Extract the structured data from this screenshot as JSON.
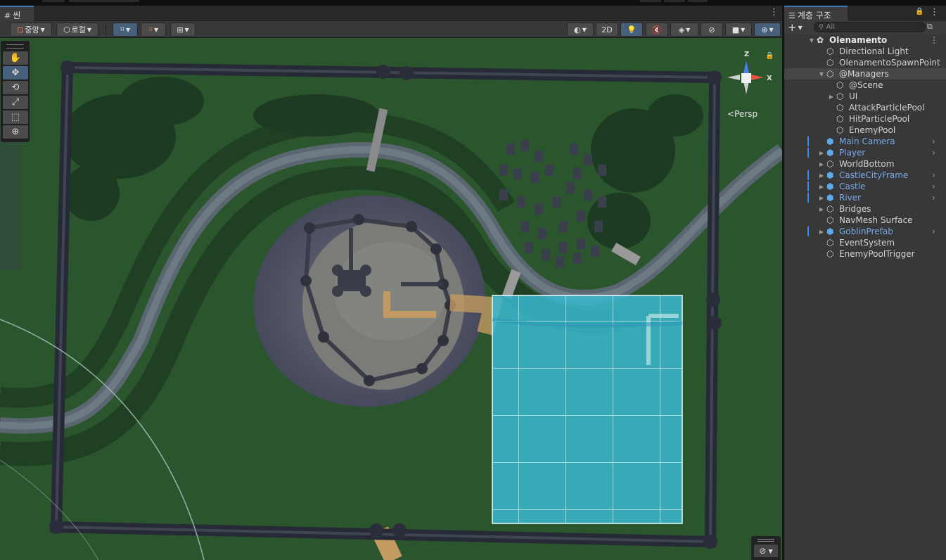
{
  "scene_panel": {
    "tab_title": "씬",
    "tab_icon": "grid-icon",
    "toolbar": {
      "pivot_label": "중앙",
      "space_label": "로컬",
      "view_2d_label": "2D"
    },
    "gizmo": {
      "axis_y": "Z",
      "axis_x": "X",
      "projection": "Persp"
    },
    "tools": [
      "hand-tool",
      "move-tool",
      "rotate-tool",
      "scale-tool",
      "rect-tool",
      "transform-tool"
    ]
  },
  "hierarchy": {
    "tab_title": "계층 구조",
    "search_placeholder": "All",
    "scene_name": "Olenamento",
    "items": [
      {
        "label": "Directional Light",
        "prefab": false,
        "expandable": false,
        "level": 1
      },
      {
        "label": "OlenamentoSpawnPoint",
        "prefab": false,
        "expandable": false,
        "level": 1
      },
      {
        "label": "@Managers",
        "prefab": false,
        "expandable": true,
        "expanded": true,
        "level": 1
      },
      {
        "label": "@Scene",
        "prefab": false,
        "expandable": false,
        "level": 2
      },
      {
        "label": "UI",
        "prefab": false,
        "expandable": true,
        "level": 2
      },
      {
        "label": "AttackParticlePool",
        "prefab": false,
        "expandable": false,
        "level": 2
      },
      {
        "label": "HitParticlePool",
        "prefab": false,
        "expandable": false,
        "level": 2
      },
      {
        "label": "EnemyPool",
        "prefab": false,
        "expandable": false,
        "level": 2
      },
      {
        "label": "Main Camera",
        "prefab": true,
        "expandable": false,
        "level": 1
      },
      {
        "label": "Player",
        "prefab": true,
        "expandable": true,
        "level": 1
      },
      {
        "label": "WorldBottom",
        "prefab": false,
        "expandable": true,
        "level": 1
      },
      {
        "label": "CastleCityFrame",
        "prefab": true,
        "expandable": true,
        "level": 1
      },
      {
        "label": "Castle",
        "prefab": true,
        "expandable": true,
        "level": 1
      },
      {
        "label": "River",
        "prefab": true,
        "expandable": true,
        "level": 1
      },
      {
        "label": "Bridges",
        "prefab": false,
        "expandable": true,
        "level": 1
      },
      {
        "label": "NavMesh Surface",
        "prefab": false,
        "expandable": false,
        "level": 1
      },
      {
        "label": "GoblinPrefab",
        "prefab": true,
        "expandable": true,
        "level": 1
      },
      {
        "label": "EventSystem",
        "prefab": false,
        "expandable": false,
        "level": 1
      },
      {
        "label": "EnemyPoolTrigger",
        "prefab": false,
        "expandable": false,
        "level": 1
      }
    ]
  },
  "colors": {
    "accent": "#3a79bb",
    "prefab_blue": "#7aa8e8",
    "water_overlay": "#3ab8d0",
    "grass": "#2d5a2e"
  }
}
